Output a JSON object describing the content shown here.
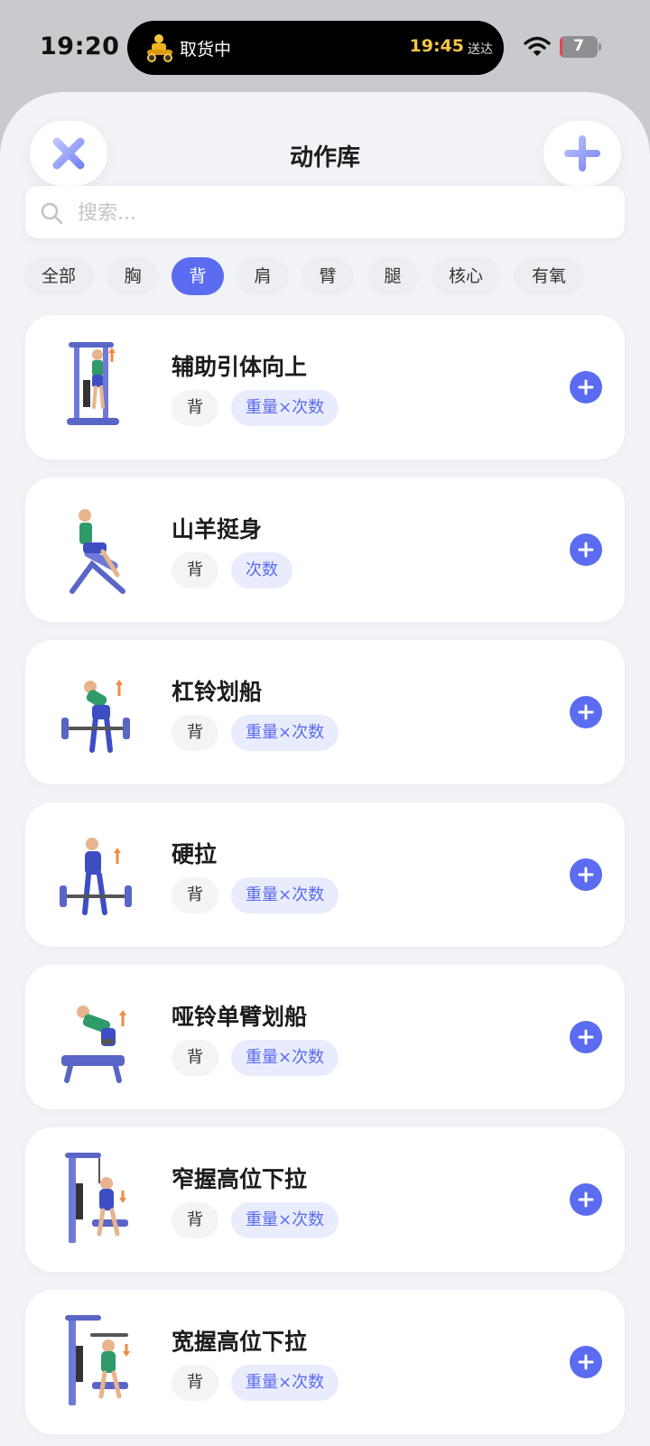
{
  "status_bar": {
    "time": "19:20",
    "activity": {
      "label": "取货中",
      "eta": "19:45",
      "eta_suffix": "送达"
    },
    "battery": {
      "level": "7",
      "fraction": 0.07,
      "color": "#e5484d"
    }
  },
  "header": {
    "title": "动作库",
    "close_icon": "close-icon",
    "add_icon": "plus-icon"
  },
  "search": {
    "placeholder": "搜索..."
  },
  "filters": {
    "items": [
      "全部",
      "胸",
      "背",
      "肩",
      "臂",
      "腿",
      "核心",
      "有氧"
    ],
    "active": "背",
    "accent": "#5b6cf0"
  },
  "exercises": [
    {
      "name": "辅助引体向上",
      "muscle": "背",
      "type": "重量×次数",
      "icon": "assisted-pullup-figure"
    },
    {
      "name": "山羊挺身",
      "muscle": "背",
      "type": "次数",
      "icon": "back-extension-figure"
    },
    {
      "name": "杠铃划船",
      "muscle": "背",
      "type": "重量×次数",
      "icon": "barbell-row-figure"
    },
    {
      "name": "硬拉",
      "muscle": "背",
      "type": "重量×次数",
      "icon": "deadlift-figure"
    },
    {
      "name": "哑铃单臂划船",
      "muscle": "背",
      "type": "重量×次数",
      "icon": "dumbbell-row-figure"
    },
    {
      "name": "窄握高位下拉",
      "muscle": "背",
      "type": "重量×次数",
      "icon": "close-grip-pulldown-figure"
    },
    {
      "name": "宽握高位下拉",
      "muscle": "背",
      "type": "重量×次数",
      "icon": "wide-grip-pulldown-figure"
    }
  ]
}
